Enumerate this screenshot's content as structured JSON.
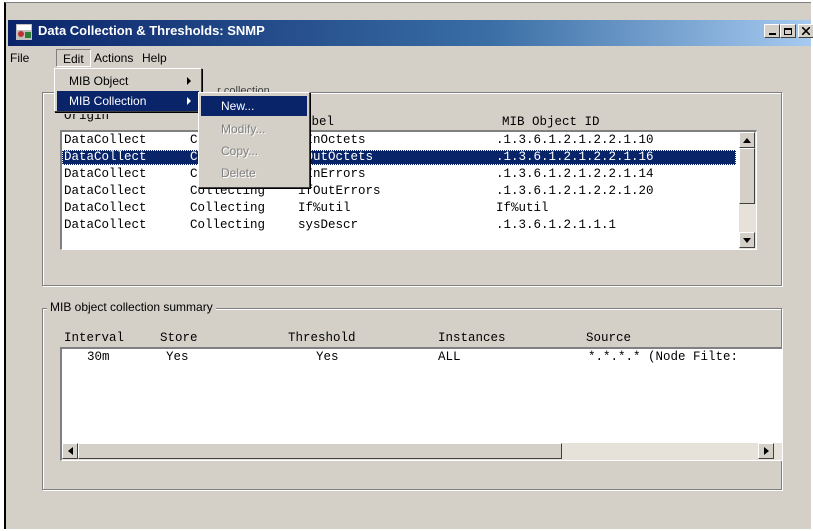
{
  "window": {
    "title": "Data Collection & Thresholds: SNMP",
    "controls": [
      "minimize-icon",
      "maximize-icon",
      "close-icon"
    ]
  },
  "menubar": {
    "items": [
      "File",
      "Edit",
      "Actions",
      "Help"
    ]
  },
  "edit_menu": {
    "items": [
      "MIB Object",
      "MIB Collection"
    ]
  },
  "collection_submenu": {
    "items": [
      {
        "label": "New...",
        "enabled": true
      },
      {
        "label": "Modify...",
        "enabled": false
      },
      {
        "label": "Copy...",
        "enabled": false
      },
      {
        "label": "Delete",
        "enabled": false
      }
    ]
  },
  "collection_group": {
    "label_fragment": "...r collection",
    "columns": [
      "Origin",
      "S",
      "abel",
      "MIB Object ID"
    ],
    "rows": [
      {
        "origin": "DataCollect",
        "status": "C",
        "label": "fInOctets",
        "mib": ".1.3.6.1.2.1.2.2.1.10",
        "selected": false
      },
      {
        "origin": "DataCollect",
        "status": "C",
        "label": "fOutOctets",
        "mib": ".1.3.6.1.2.1.2.2.1.16",
        "selected": true
      },
      {
        "origin": "DataCollect",
        "status": "C",
        "label": "fInErrors",
        "mib": ".1.3.6.1.2.1.2.2.1.14",
        "selected": false
      },
      {
        "origin": "DataCollect",
        "status": "Collecting",
        "label": "ifOutErrors",
        "mib": ".1.3.6.1.2.1.2.2.1.20",
        "selected": false
      },
      {
        "origin": "DataCollect",
        "status": "Collecting",
        "label": "If%util",
        "mib": "If%util",
        "selected": false
      },
      {
        "origin": "DataCollect",
        "status": "Collecting",
        "label": "sysDescr",
        "mib": ".1.3.6.1.2.1.1.1",
        "selected": false
      }
    ]
  },
  "summary_group": {
    "label": "MIB object collection summary",
    "columns": [
      "Interval",
      "Store",
      "Threshold",
      "Instances",
      "Source"
    ],
    "rows": [
      {
        "interval": "30m",
        "store": "Yes",
        "threshold": "Yes",
        "instances": "ALL",
        "source": "*.*.*.* (Node Filte:"
      }
    ]
  },
  "colors": {
    "title_start": "#0a246a",
    "title_end": "#a6caf0",
    "selection": "#0a246a",
    "face": "#d4d0c8"
  }
}
